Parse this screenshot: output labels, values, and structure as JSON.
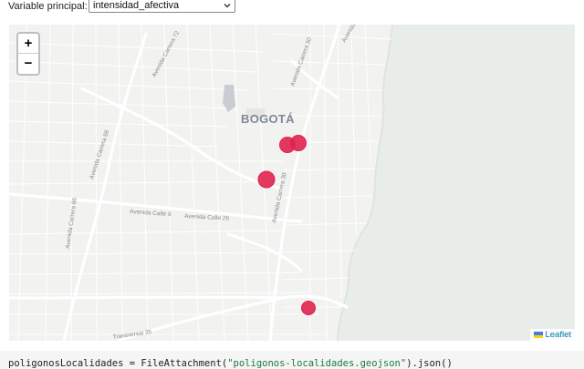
{
  "controls": {
    "variable_label": "Variable principal:",
    "variable_selected": "intensidad_afectiva"
  },
  "map": {
    "city_label": "BOGOTÁ",
    "street_labels": {
      "carrera72": "Avenida Carrera 72",
      "carrera68": "Avenida Carrera 68",
      "carrera30_top": "Avenida Carrera 30",
      "carrera30_mid": "Avenida Carrera 30",
      "carrera50": "Avenida Carrera 50",
      "calle9": "Avenida Calle 9",
      "calle26": "Avenida Calle 26",
      "carrera86": "Avenida Carrera 86",
      "transversal": "Transversal 35"
    },
    "marker_color": "#e0234e",
    "zoom_in": "+",
    "zoom_out": "−",
    "attribution": "Leaflet"
  },
  "code": {
    "prefix": "poligonosLocalidades = FileAttachment(",
    "string": "\"poligonos-localidades.geojson\"",
    "suffix": ").json()"
  }
}
